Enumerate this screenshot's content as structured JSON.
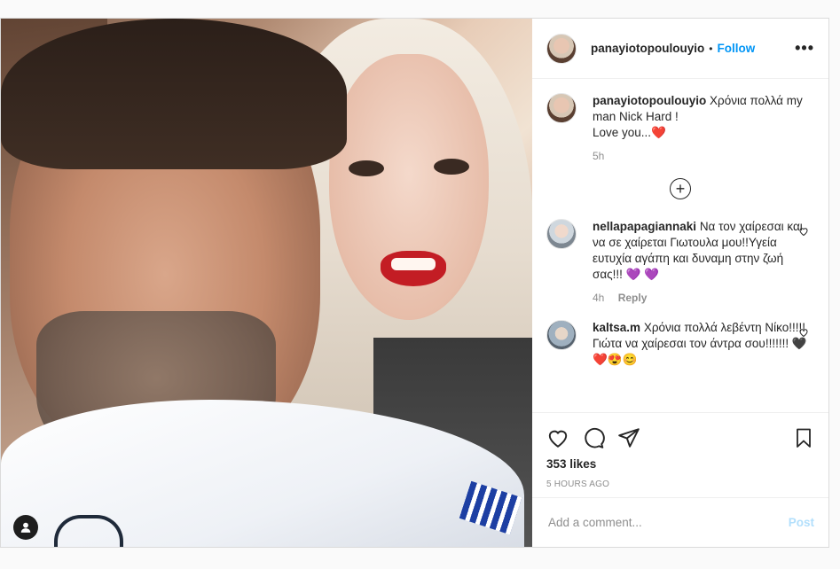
{
  "post": {
    "username": "panayiotopoulouyio",
    "separator": "•",
    "follow_label": "Follow",
    "more_icon": "more-options-icon"
  },
  "caption": {
    "username": "panayiotopoulouyio",
    "text_line1": "Χρόνια πολλά my man Nick Hard !",
    "text_line2": "Love you...",
    "emoji": "❤️",
    "time": "5h"
  },
  "comments": [
    {
      "username": "nellapapagiannaki",
      "text": "Να τον χαίρεσαι και να σε χαίρεται Γιωτουλα μου!!Υγεία ευτυχία αγάπη και δυναμη στην ζωή σας!!!",
      "emoji": "💜 💜",
      "time": "4h",
      "reply_label": "Reply"
    },
    {
      "username": "kaltsa.m",
      "text": "Χρόνια πολλά λεβέντη Νίκο!!!!!Γιώτα να χαίρεσαι τον άντρα σου!!!!!!!",
      "emoji": "🖤❤️😍😊",
      "time": "",
      "reply_label": ""
    }
  ],
  "actions": {
    "likes": "353 likes",
    "posted_time": "5 HOURS AGO"
  },
  "add_comment": {
    "placeholder": "Add a comment...",
    "post_label": "Post"
  },
  "colors": {
    "accent": "#0095f6",
    "post_disabled": "#b2dffc",
    "heart": "#e0245e",
    "purple_heart": "#8c5bd6"
  }
}
